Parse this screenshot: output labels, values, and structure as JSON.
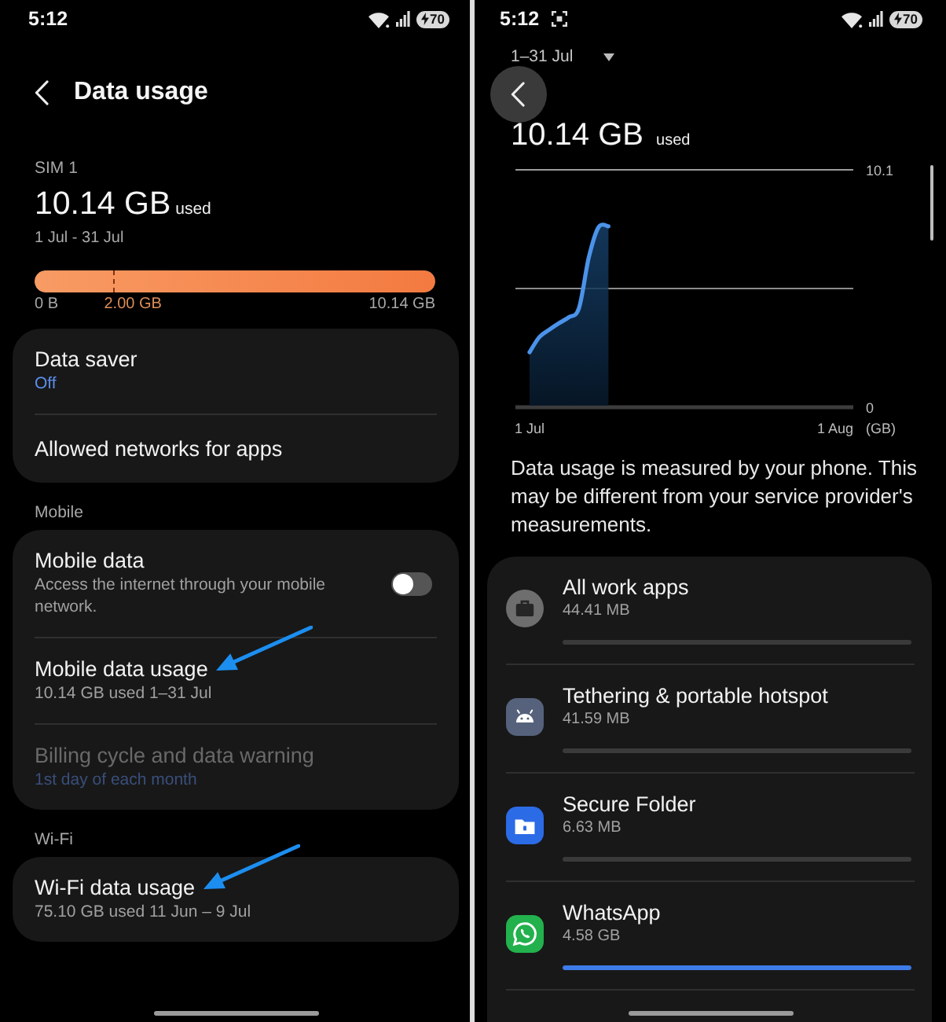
{
  "left_screen": {
    "status_bar": {
      "time": "5:12",
      "battery": "70"
    },
    "header": {
      "title": "Data usage"
    },
    "summary": {
      "sim": "SIM 1",
      "amount": "10.14 GB",
      "unit": "used",
      "period": "1 Jul - 31 Jul",
      "level": 1,
      "min_label": "0 B",
      "max_label": "10.14 GB",
      "warning": {
        "label": "2.00 GB",
        "level": 0.197
      }
    },
    "sections": [
      {
        "items": [
          {
            "kind": "link",
            "title": "Data saver",
            "summary": "Off",
            "disabled": false,
            "annotated": false
          },
          {
            "kind": "link",
            "title": "Allowed networks for apps",
            "disabled": false,
            "annotated": false
          }
        ]
      },
      {
        "header": "Mobile",
        "items": [
          {
            "kind": "switch",
            "title": "Mobile data",
            "description": "Access the internet through your mobile network.",
            "on": false,
            "disabled": false,
            "annotated": false
          },
          {
            "kind": "link",
            "title": "Mobile data usage",
            "description": "10.14 GB used 1–31 Jul",
            "disabled": false,
            "annotated": true
          },
          {
            "kind": "link",
            "title": "Billing cycle and data warning",
            "summary": "1st day of each month",
            "disabled": true,
            "annotated": false
          }
        ]
      },
      {
        "header": "Wi-Fi",
        "items": [
          {
            "kind": "link",
            "title": "Wi-Fi data usage",
            "description": "75.10 GB used 11 Jun – 9 Jul",
            "disabled": false,
            "annotated": true
          }
        ]
      }
    ]
  },
  "right_screen": {
    "status_bar": {
      "time": "5:12",
      "battery": "70",
      "screenshot_notification": true
    },
    "period": "1–31 Jul",
    "total": {
      "amount": "10.14 GB",
      "unit": "used"
    },
    "chart_data": {
      "type": "area",
      "ylabel": "(GB)",
      "categories": [
        "1 Jul",
        null,
        null,
        null,
        null,
        null,
        null,
        null,
        null,
        null,
        null,
        null,
        null,
        null,
        null,
        null,
        null,
        null,
        null,
        null,
        null,
        null,
        null,
        null,
        null,
        null,
        null,
        null,
        null,
        null,
        null,
        "1 Aug"
      ],
      "values": [
        2.34,
        2.99,
        3.3,
        3.58,
        3.83,
        4.21,
        6.35,
        7.66,
        7.7,
        null,
        null,
        null,
        null,
        null,
        null,
        null,
        null,
        null,
        null,
        null,
        null,
        null,
        null,
        null,
        null,
        null,
        null,
        null,
        null,
        null,
        null,
        null
      ],
      "ylim": [
        0,
        10.1
      ],
      "yticks": [
        0,
        10.1
      ],
      "ref_lines": [
        {
          "axis": "y",
          "value": 5.05
        }
      ]
    },
    "note": "Data usage is measured by your phone. This may be different from your service provider's measurements.",
    "apps": [
      {
        "kind": "work",
        "name": "All work apps",
        "usage": "44.41 MB",
        "level": 0
      },
      {
        "kind": "android",
        "name": "Tethering & portable hotspot",
        "usage": "41.59 MB",
        "level": 0
      },
      {
        "kind": "folder",
        "name": "Secure Folder",
        "usage": "6.63 MB",
        "level": 0
      },
      {
        "kind": "chat",
        "name": "WhatsApp",
        "usage": "4.58 GB",
        "level": 1
      }
    ]
  }
}
